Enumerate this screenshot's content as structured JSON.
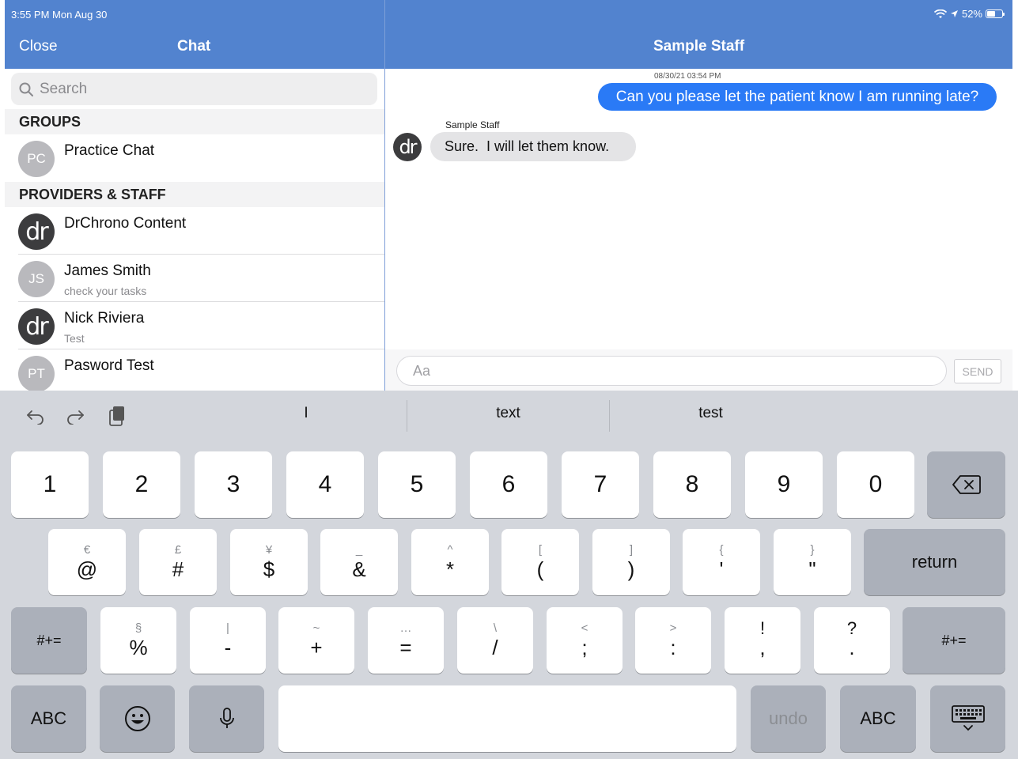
{
  "status_bar": {
    "time": "3:55 PM  Mon Aug 30",
    "battery": "52%"
  },
  "left_header": {
    "close_label": "Close",
    "title": "Chat"
  },
  "right_header": {
    "title": "Sample Staff"
  },
  "search": {
    "placeholder": "Search"
  },
  "groups": {
    "header": "GROUPS",
    "items": [
      {
        "initials": "PC",
        "name": "Practice Chat",
        "sub": ""
      }
    ]
  },
  "providers": {
    "header": "PROVIDERS & STAFF",
    "items": [
      {
        "initials": "dr",
        "name": "DrChrono Content",
        "sub": ""
      },
      {
        "initials": "JS",
        "name": "James Smith",
        "sub": "check your tasks"
      },
      {
        "initials": "dr",
        "name": "Nick Riviera",
        "sub": "Test"
      },
      {
        "initials": "PT",
        "name": "Pasword Test",
        "sub": ""
      }
    ]
  },
  "conversation": {
    "outgoing_time": "08/30/21 03:54 PM",
    "outgoing_text": "Can you please let the patient know I am running late?",
    "incoming_sender": "Sample Staff",
    "incoming_avatar": "dr",
    "incoming_text": "Sure.  I will let them know."
  },
  "composer": {
    "placeholder": "Aa",
    "send_label": "SEND"
  },
  "keyboard": {
    "suggestions": [
      "I",
      "text",
      "test"
    ],
    "row1": [
      "1",
      "2",
      "3",
      "4",
      "5",
      "6",
      "7",
      "8",
      "9",
      "0"
    ],
    "row2": [
      {
        "alt": "€",
        "main": "@"
      },
      {
        "alt": "£",
        "main": "#"
      },
      {
        "alt": "¥",
        "main": "$"
      },
      {
        "alt": "_",
        "main": "&"
      },
      {
        "alt": "^",
        "main": "*"
      },
      {
        "alt": "[",
        "main": "("
      },
      {
        "alt": "]",
        "main": ")"
      },
      {
        "alt": "{",
        "main": "'"
      },
      {
        "alt": "}",
        "main": "\""
      }
    ],
    "row3": [
      {
        "alt": "§",
        "main": "%"
      },
      {
        "alt": "|",
        "main": "-"
      },
      {
        "alt": "~",
        "main": "+"
      },
      {
        "alt": "…",
        "main": "="
      },
      {
        "alt": "\\",
        "main": "/"
      },
      {
        "alt": "<",
        "main": ";"
      },
      {
        "alt": ">",
        "main": ":"
      },
      {
        "alt": "!",
        "main": ","
      },
      {
        "alt": "?",
        "main": "."
      }
    ],
    "return_label": "return",
    "more_symbols_label": "#+=",
    "abc_label": "ABC",
    "undo_label": "undo"
  }
}
